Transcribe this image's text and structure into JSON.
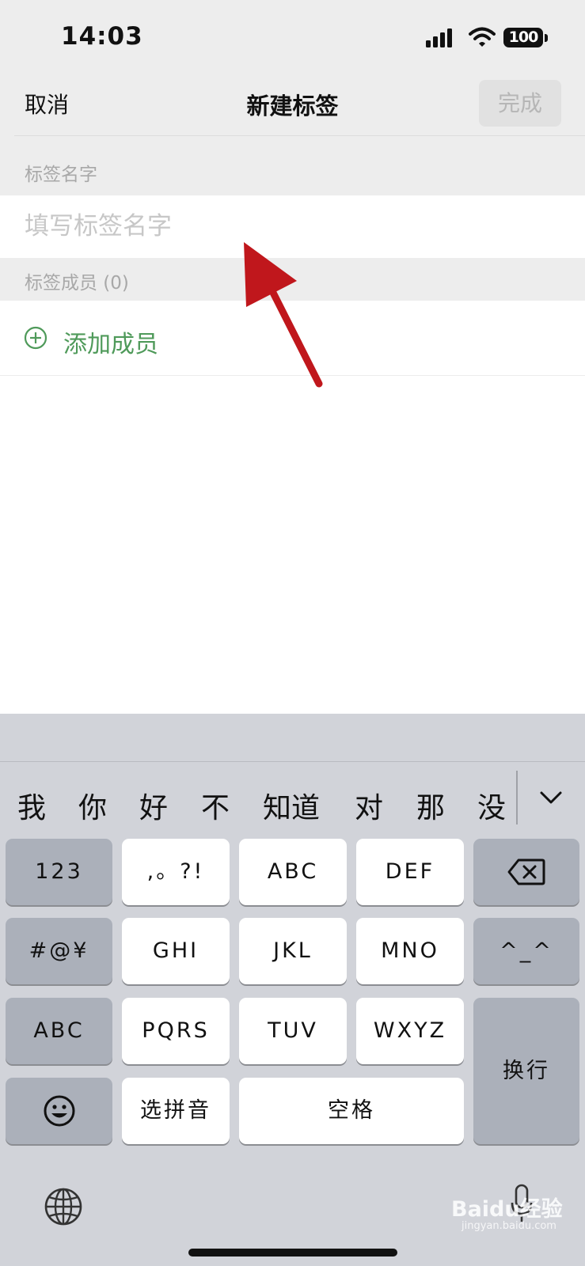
{
  "status_bar": {
    "time": "14:03",
    "battery": "100"
  },
  "nav": {
    "cancel": "取消",
    "title": "新建标签",
    "done": "完成"
  },
  "tag_name": {
    "section_label": "标签名字",
    "placeholder": "填写标签名字",
    "value": ""
  },
  "members": {
    "section_label": "标签成员 (0)",
    "add_label": "添加成员"
  },
  "colors": {
    "accent_green": "#4f9a5a",
    "arrow_red": "#c0171c"
  },
  "keyboard": {
    "candidates": [
      "我",
      "你",
      "好",
      "不",
      "知道",
      "对",
      "那",
      "没"
    ],
    "keys": {
      "num": "123",
      "punct": ",。?!",
      "abc": "ABC",
      "def": "DEF",
      "symbols": "#@¥",
      "ghi": "GHI",
      "jkl": "JKL",
      "mno": "MNO",
      "emoticon": "^_^",
      "abc_switch": "ABC",
      "pqrs": "PQRS",
      "tuv": "TUV",
      "wxyz": "WXYZ",
      "enter": "换行",
      "select_pinyin": "选拼音",
      "space": "空格"
    },
    "icons": [
      "delete-icon",
      "emoji-icon",
      "globe-icon",
      "mic-icon",
      "collapse-icon"
    ]
  },
  "watermark": {
    "brand": "Baidu经验",
    "url": "jingyan.baidu.com"
  }
}
